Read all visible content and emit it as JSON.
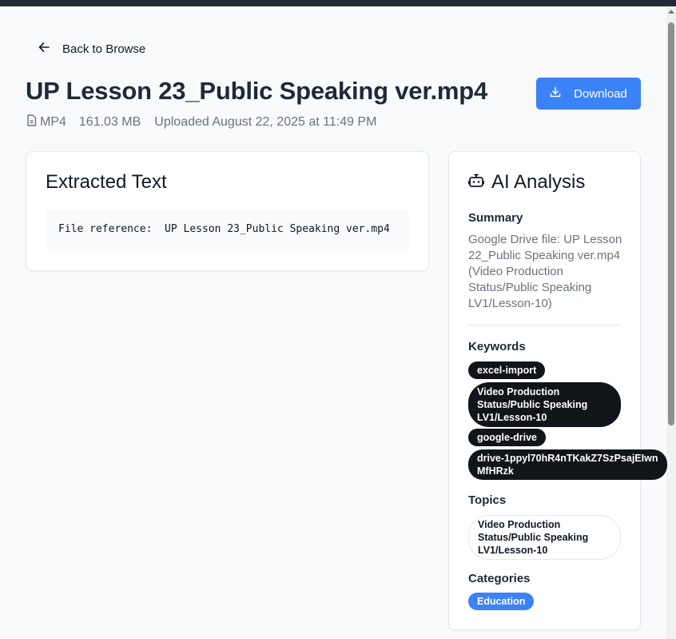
{
  "nav": {
    "back_label": "Back to Browse"
  },
  "file": {
    "title": "UP Lesson 23_Public Speaking ver.mp4",
    "type": "MP4",
    "size": "161.03 MB",
    "uploaded": "Uploaded August 22, 2025 at 11:49 PM"
  },
  "actions": {
    "download_label": "Download"
  },
  "extracted": {
    "title": "Extracted Text",
    "text": "File reference:  UP Lesson 23_Public Speaking ver.mp4"
  },
  "ai": {
    "title": "AI Analysis",
    "summary_label": "Summary",
    "summary": "Google Drive file: UP Lesson 22_Public Speaking ver.mp4 (Video Production Status/Public Speaking LV1/Lesson-10)",
    "keywords_label": "Keywords",
    "keywords": [
      "excel-import",
      "Video Production Status/Public Speaking LV1/Lesson-10",
      "google-drive",
      "drive-1ppyl70hR4nTKakZ7SzPsajEIwnMfHRzk"
    ],
    "topics_label": "Topics",
    "topics": [
      "Video Production Status/Public Speaking LV1/Lesson-10"
    ],
    "categories_label": "Categories",
    "categories": [
      "Education"
    ]
  },
  "icons": {
    "back": "arrow-left-icon",
    "file": "file-document-icon",
    "download": "download-icon",
    "ai": "robot-icon"
  },
  "colors": {
    "accent": "#3b82f6",
    "keyword_bg": "#111418",
    "page_bg": "#f9fafb"
  }
}
